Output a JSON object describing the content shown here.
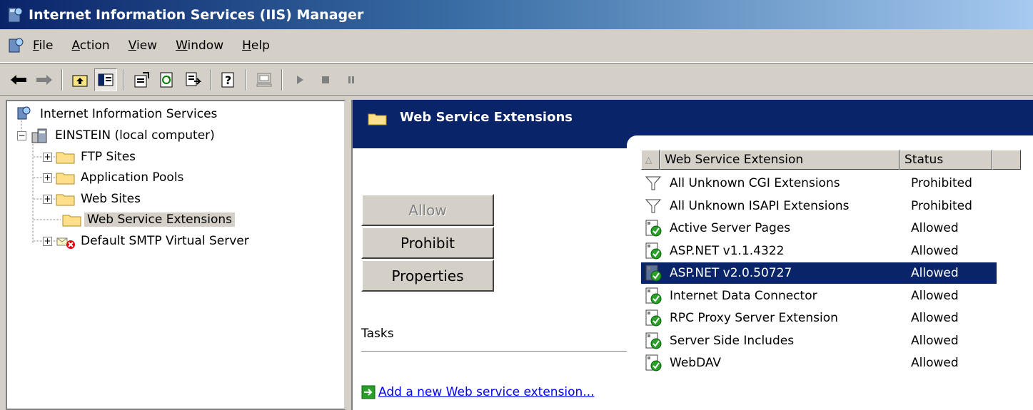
{
  "window": {
    "title": "Internet Information Services (IIS) Manager"
  },
  "menu": {
    "items": [
      "File",
      "Action",
      "View",
      "Window",
      "Help"
    ]
  },
  "toolbar": {
    "buttons": [
      "back-icon",
      "forward-icon",
      "up-level-icon",
      "show-hide-tree-icon",
      "properties-icon",
      "refresh-icon",
      "export-list-icon",
      "help-icon",
      "computer-icon",
      "play-icon",
      "stop-icon",
      "pause-icon"
    ]
  },
  "tree": {
    "root": "Internet Information Services",
    "server": "EINSTEIN (local computer)",
    "children": [
      "FTP Sites",
      "Application Pools",
      "Web Sites",
      "Web Service Extensions",
      "Default SMTP Virtual Server"
    ],
    "selected": "Web Service Extensions"
  },
  "panel": {
    "title": "Web Service Extensions",
    "buttons": {
      "allow": "Allow",
      "prohibit": "Prohibit",
      "properties": "Properties"
    },
    "tasks_label": "Tasks",
    "task_link": "Add a new Web service extension..."
  },
  "list": {
    "columns": {
      "sort": "",
      "name": "Web Service Extension",
      "status": "Status"
    },
    "rows": [
      {
        "name": "All Unknown CGI Extensions",
        "status": "Prohibited",
        "icon": "filter-icon"
      },
      {
        "name": "All Unknown ISAPI Extensions",
        "status": "Prohibited",
        "icon": "filter-icon"
      },
      {
        "name": "Active Server Pages",
        "status": "Allowed",
        "icon": "extension-allowed-icon"
      },
      {
        "name": "ASP.NET v1.1.4322",
        "status": "Allowed",
        "icon": "extension-allowed-icon"
      },
      {
        "name": "ASP.NET v2.0.50727",
        "status": "Allowed",
        "icon": "extension-allowed-icon",
        "selected": true
      },
      {
        "name": "Internet Data Connector",
        "status": "Allowed",
        "icon": "extension-allowed-icon"
      },
      {
        "name": "RPC Proxy Server Extension",
        "status": "Allowed",
        "icon": "extension-allowed-icon"
      },
      {
        "name": "Server Side Includes",
        "status": "Allowed",
        "icon": "extension-allowed-icon"
      },
      {
        "name": "WebDAV",
        "status": "Allowed",
        "icon": "extension-allowed-icon"
      }
    ]
  },
  "colors": {
    "titlebar": "#0a246a",
    "selection": "#0a246a",
    "face": "#d4d0c8",
    "link": "#0000ff"
  }
}
